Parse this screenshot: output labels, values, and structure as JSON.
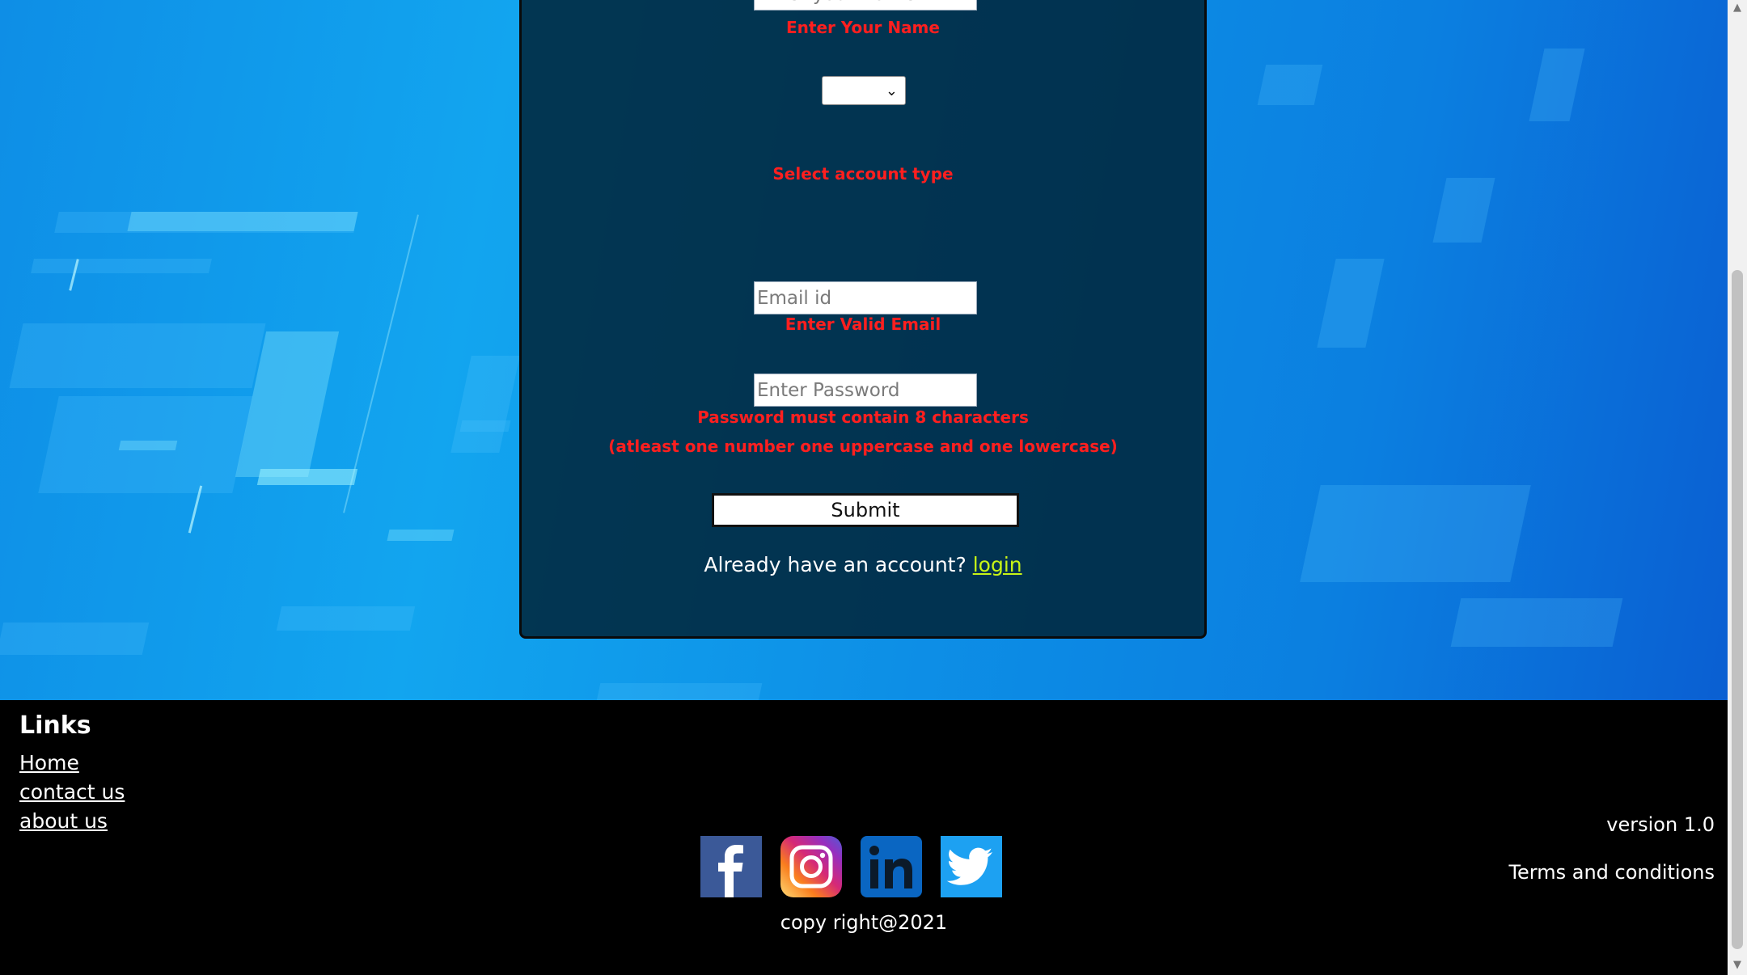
{
  "form": {
    "name_placeholder": "Enter your Name",
    "name_error": "Enter Your Name",
    "account_type_value": "",
    "account_type_error": "Select account type",
    "email_placeholder": "Email id",
    "email_error": "Enter Valid Email",
    "password_placeholder": "Enter Password",
    "password_error_line1": "Password must contain 8 characters",
    "password_error_line2": "(atleast one number one uppercase and one lowercase)",
    "submit_label": "Submit",
    "login_prompt": "Already have an account?",
    "login_link": "login"
  },
  "footer": {
    "links_title": "Links",
    "links": [
      "Home",
      "contact us",
      "about us"
    ],
    "social_icons": [
      "facebook-icon",
      "instagram-icon",
      "linkedin-icon",
      "twitter-icon"
    ],
    "copyright": "copy right@2021",
    "version": "version 1.0",
    "terms": "Terms and conditions"
  },
  "colors": {
    "error": "#ff1f1f",
    "login_link": "#c8f516",
    "card_bg": "#002438",
    "footer_bg": "#000000"
  }
}
